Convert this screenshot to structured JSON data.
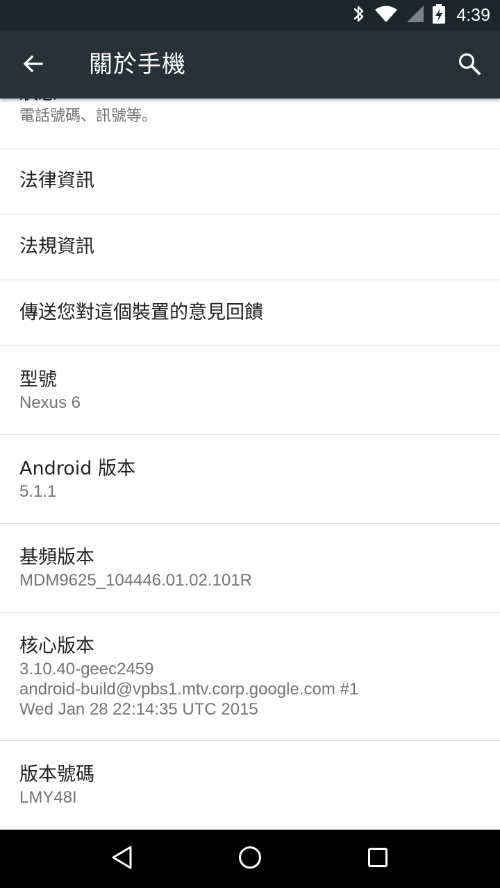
{
  "status_bar": {
    "time": "4:39",
    "icons": [
      "bluetooth-icon",
      "wifi-icon",
      "cell-signal-icon",
      "battery-charging-icon"
    ]
  },
  "toolbar": {
    "title": "關於手機",
    "back_icon": "arrow-back-icon",
    "search_icon": "search-icon"
  },
  "list": [
    {
      "id": "status",
      "title": "狀態",
      "summary": "電話號碼、訊號等。"
    },
    {
      "id": "legal",
      "title": "法律資訊",
      "summary": ""
    },
    {
      "id": "regulatory",
      "title": "法規資訊",
      "summary": ""
    },
    {
      "id": "feedback",
      "title": "傳送您對這個裝置的意見回饋",
      "summary": ""
    },
    {
      "id": "model",
      "title": "型號",
      "summary": "Nexus 6"
    },
    {
      "id": "android-version",
      "title": "Android 版本",
      "summary": "5.1.1"
    },
    {
      "id": "baseband",
      "title": "基頻版本",
      "summary": "MDM9625_104446.01.02.101R"
    },
    {
      "id": "kernel",
      "title": "核心版本",
      "summary": "3.10.40-geec2459\nandroid-build@vpbs1.mtv.corp.google.com #1\nWed Jan 28 22:14:35 UTC 2015"
    },
    {
      "id": "build-number",
      "title": "版本號碼",
      "summary": "LMY48I"
    }
  ],
  "nav_bar": {
    "buttons": [
      "back-triangle-icon",
      "home-circle-icon",
      "recents-square-icon"
    ]
  }
}
